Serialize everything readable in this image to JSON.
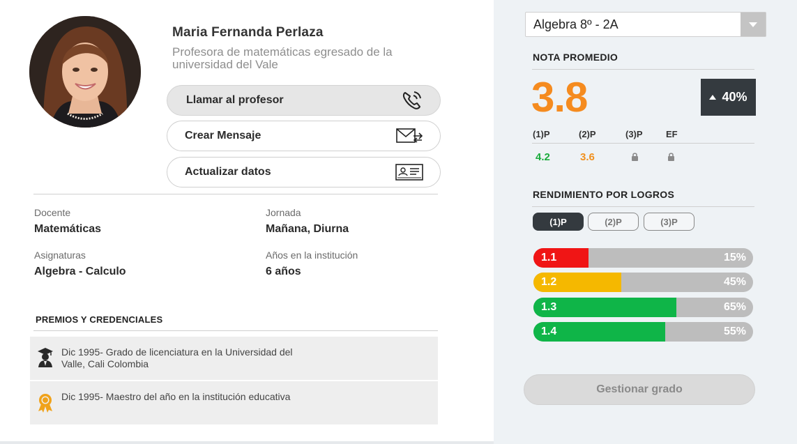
{
  "profile": {
    "name": "Maria Fernanda Perlaza",
    "subtitle": "Profesora de matemáticas egresado de la universidad del Vale"
  },
  "actions": {
    "call": "Llamar al profesor",
    "message": "Crear Mensaje",
    "update": "Actualizar datos"
  },
  "info": {
    "docente_label": "Docente",
    "docente_value": "Matemáticas",
    "jornada_label": "Jornada",
    "jornada_value": "Mañana, Diurna",
    "asignaturas_label": "Asignaturas",
    "asignaturas_value": "Algebra - Calculo",
    "anos_label": "Años en la institución",
    "anos_value": "6 años"
  },
  "premios": {
    "title": "PREMIOS Y CREDENCIALES",
    "items": [
      {
        "text": "Dic 1995- Grado de licenciatura en la Universidad del Valle, Cali Colombia",
        "icon": "graduate-icon"
      },
      {
        "text": "Dic 1995- Maestro del año en la institución educativa",
        "icon": "award-medal-icon"
      }
    ]
  },
  "course_select": {
    "value": "Algebra 8º - 2A"
  },
  "nota": {
    "title": "NOTA PROMEDIO",
    "value": "3.8",
    "delta": "40%",
    "periods": [
      {
        "label": "(1)P",
        "value": "4.2",
        "color": "#1aab3c",
        "locked": false
      },
      {
        "label": "(2)P",
        "value": "3.6",
        "color": "#f0901e",
        "locked": false
      },
      {
        "label": "(3)P",
        "value": "",
        "locked": true
      },
      {
        "label": "EF",
        "value": "",
        "locked": true
      }
    ]
  },
  "rendimiento": {
    "title": "RENDIMIENTO POR LOGROS",
    "tabs": [
      "(1)P",
      "(2)P",
      "(3)P"
    ],
    "active_tab": 0,
    "bars": [
      {
        "label": "1.1",
        "percent": "15%",
        "fraction": 0.25,
        "color": "#f01515"
      },
      {
        "label": "1.2",
        "percent": "45%",
        "fraction": 0.4,
        "color": "#f5b800"
      },
      {
        "label": "1.3",
        "percent": "65%",
        "fraction": 0.65,
        "color": "#0fb548"
      },
      {
        "label": "1.4",
        "percent": "55%",
        "fraction": 0.6,
        "color": "#0fb548"
      }
    ]
  },
  "gestionar": "Gestionar grado"
}
